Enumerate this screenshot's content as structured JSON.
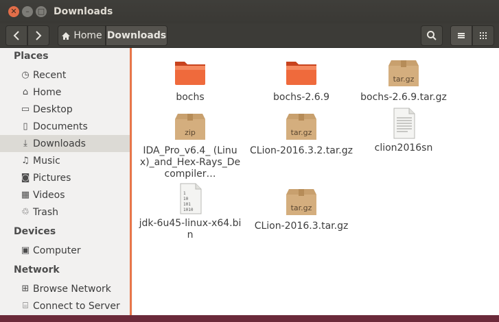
{
  "window": {
    "title": "Downloads"
  },
  "toolbar": {
    "breadcrumb": [
      {
        "label": "Home",
        "icon": "home-icon"
      },
      {
        "label": "Downloads"
      }
    ]
  },
  "sidebar": {
    "sections": [
      {
        "label": "Places"
      },
      {
        "label": "Devices"
      },
      {
        "label": "Network"
      }
    ],
    "places": [
      {
        "label": "Recent",
        "icon": "clock-icon"
      },
      {
        "label": "Home",
        "icon": "home-icon"
      },
      {
        "label": "Desktop",
        "icon": "desktop-icon"
      },
      {
        "label": "Documents",
        "icon": "document-icon"
      },
      {
        "label": "Downloads",
        "icon": "download-icon",
        "active": true
      },
      {
        "label": "Music",
        "icon": "music-icon"
      },
      {
        "label": "Pictures",
        "icon": "camera-icon"
      },
      {
        "label": "Videos",
        "icon": "video-icon"
      },
      {
        "label": "Trash",
        "icon": "trash-icon"
      }
    ],
    "devices": [
      {
        "label": "Computer",
        "icon": "computer-icon"
      }
    ],
    "network": [
      {
        "label": "Browse Network",
        "icon": "network-icon"
      },
      {
        "label": "Connect to Server",
        "icon": "server-icon"
      }
    ]
  },
  "files": [
    {
      "name": "bochs",
      "type": "folder"
    },
    {
      "name": "bochs-2.6.9",
      "type": "folder"
    },
    {
      "name": "bochs-2.6.9.tar.gz",
      "type": "archive",
      "badge": "tar.gz"
    },
    {
      "name": "IDA_Pro_v6.4_ (Linux)_and_Hex-Rays_Decompiler…",
      "type": "archive",
      "badge": "zip"
    },
    {
      "name": "CLion-2016.3.2.tar.gz",
      "type": "archive",
      "badge": "tar.gz"
    },
    {
      "name": "clion2016sn",
      "type": "text"
    },
    {
      "name": "jdk-6u45-linux-x64.bin",
      "type": "binary",
      "badge": "1 10 101 1010"
    },
    {
      "name": "CLion-2016.3.tar.gz",
      "type": "archive",
      "badge": "tar.gz"
    }
  ],
  "colors": {
    "accent": "#e8764a",
    "folder": "#e9572a",
    "archive": "#c8a06e"
  }
}
